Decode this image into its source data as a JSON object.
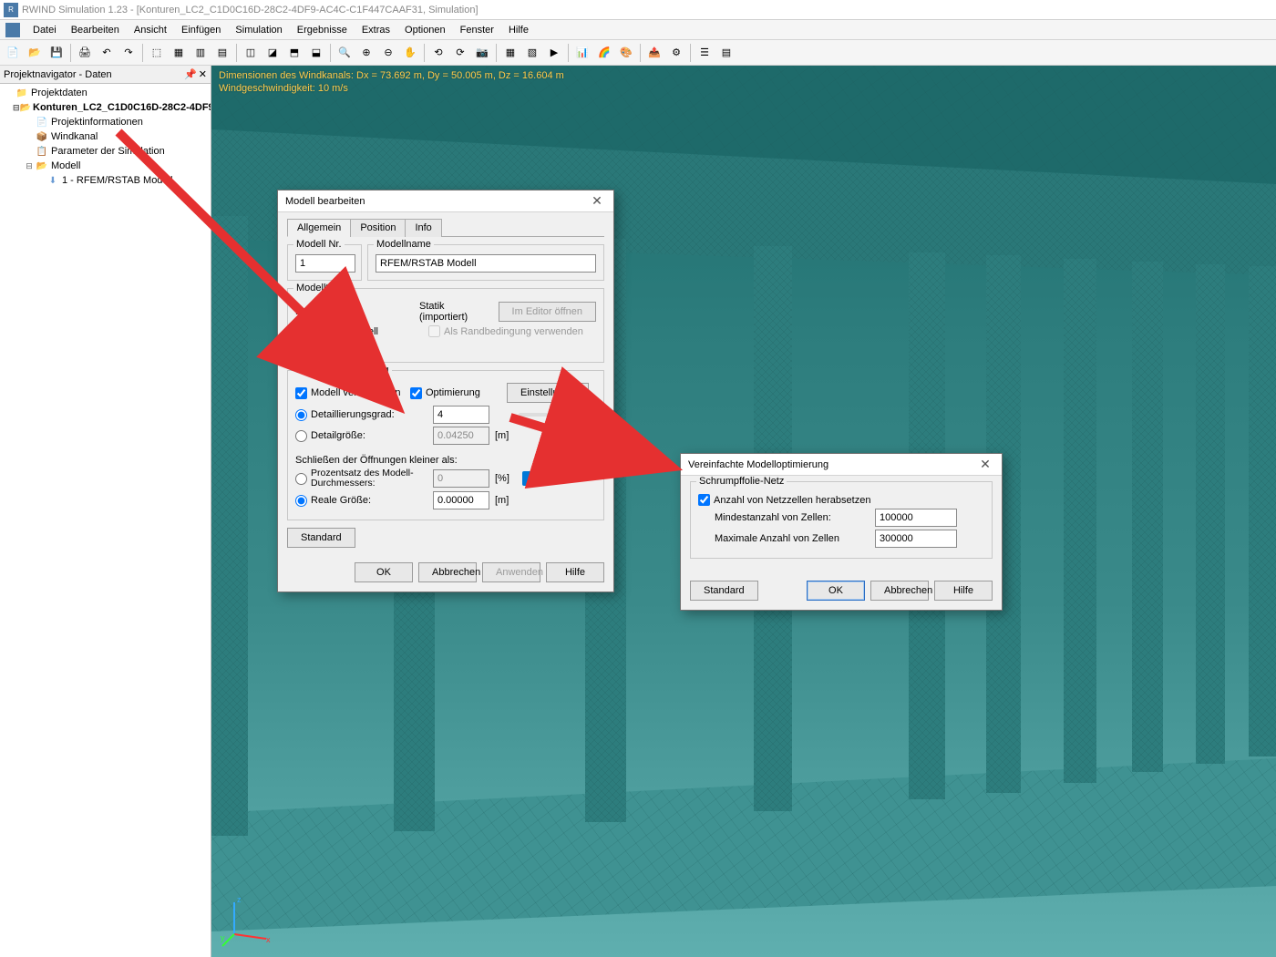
{
  "title": "RWIND Simulation 1.23 - [Konturen_LC2_C1D0C16D-28C2-4DF9-AC4C-C1F447CAAF31, Simulation]",
  "menu": [
    "Datei",
    "Bearbeiten",
    "Ansicht",
    "Einfügen",
    "Simulation",
    "Ergebnisse",
    "Extras",
    "Optionen",
    "Fenster",
    "Hilfe"
  ],
  "nav": {
    "title": "Projektnavigator - Daten",
    "items": {
      "root": "Projektdaten",
      "project": "Konturen_LC2_C1D0C16D-28C2-4DF9",
      "info": "Projektinformationen",
      "wind": "Windkanal",
      "params": "Parameter der Simulation",
      "model": "Modell",
      "rfem": "1 - RFEM/RSTAB Modell"
    }
  },
  "overlay": {
    "line1": "Dimensionen des Windkanals: Dx = 73.692 m, Dy = 50.005 m, Dz = 16.604 m",
    "line2": "Windgeschwindigkeit: 10 m/s"
  },
  "dialog1": {
    "title": "Modell bearbeiten",
    "tabs": [
      "Allgemein",
      "Position",
      "Info"
    ],
    "modelNr": {
      "label": "Modell Nr.",
      "value": "1"
    },
    "modelName": {
      "label": "Modellname",
      "value": "RFEM/RSTAB Modell"
    },
    "typeGroup": "Modelltyp",
    "structure": {
      "label": "Modelltyp:",
      "value": "Statik (importiert)"
    },
    "terrain": "Geländemodell",
    "primary": "Primärmodell",
    "editorBtn": "Im Editor öffnen",
    "boundary": "Als Randbedingung verwenden",
    "simplGroup": "Modellvereinfachung",
    "simplify": "Modell vereinfachen",
    "optimize": "Optimierung",
    "settingsBtn": "Einstellungen...",
    "detailLevel": {
      "label": "Detaillierungsgrad:",
      "value": "4"
    },
    "detailSize": {
      "label": "Detailgröße:",
      "value": "0.04250",
      "unit": "[m]"
    },
    "closeLabel": "Schließen der Öffnungen kleiner als:",
    "percent": {
      "label": "Prozentsatz des Modell-Durchmessers:",
      "value": "0",
      "unit": "[%]"
    },
    "realSize": {
      "label": "Reale Größe:",
      "value": "0.00000",
      "unit": "[m]"
    },
    "stdBtn": "Standard",
    "ok": "OK",
    "cancel": "Abbrechen",
    "apply": "Anwenden",
    "help": "Hilfe"
  },
  "dialog2": {
    "title": "Vereinfachte Modelloptimierung",
    "group": "Schrumpffolie-Netz",
    "reduce": "Anzahl von Netzzellen herabsetzen",
    "min": {
      "label": "Mindestanzahl von Zellen:",
      "value": "100000"
    },
    "max": {
      "label": "Maximale Anzahl von Zellen",
      "value": "300000"
    },
    "stdBtn": "Standard",
    "ok": "OK",
    "cancel": "Abbrechen",
    "help": "Hilfe"
  }
}
